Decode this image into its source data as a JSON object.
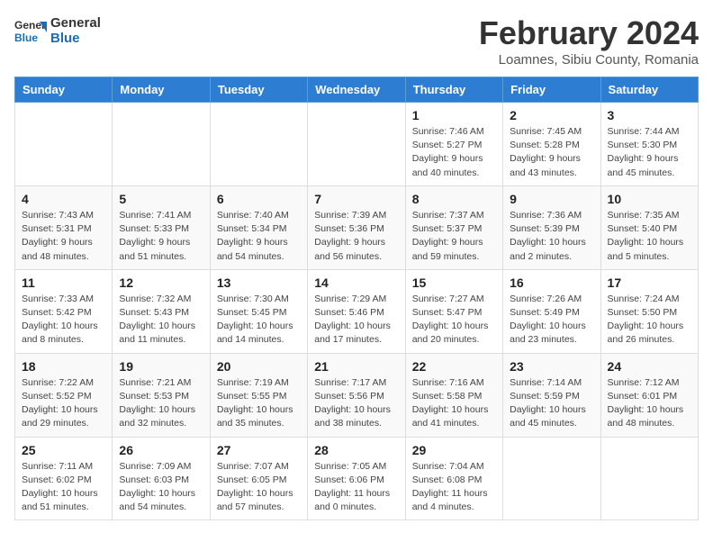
{
  "header": {
    "logo_line1": "General",
    "logo_line2": "Blue",
    "month_title": "February 2024",
    "subtitle": "Loamnes, Sibiu County, Romania"
  },
  "days_of_week": [
    "Sunday",
    "Monday",
    "Tuesday",
    "Wednesday",
    "Thursday",
    "Friday",
    "Saturday"
  ],
  "weeks": [
    [
      {
        "day": "",
        "info": ""
      },
      {
        "day": "",
        "info": ""
      },
      {
        "day": "",
        "info": ""
      },
      {
        "day": "",
        "info": ""
      },
      {
        "day": "1",
        "info": "Sunrise: 7:46 AM\nSunset: 5:27 PM\nDaylight: 9 hours\nand 40 minutes."
      },
      {
        "day": "2",
        "info": "Sunrise: 7:45 AM\nSunset: 5:28 PM\nDaylight: 9 hours\nand 43 minutes."
      },
      {
        "day": "3",
        "info": "Sunrise: 7:44 AM\nSunset: 5:30 PM\nDaylight: 9 hours\nand 45 minutes."
      }
    ],
    [
      {
        "day": "4",
        "info": "Sunrise: 7:43 AM\nSunset: 5:31 PM\nDaylight: 9 hours\nand 48 minutes."
      },
      {
        "day": "5",
        "info": "Sunrise: 7:41 AM\nSunset: 5:33 PM\nDaylight: 9 hours\nand 51 minutes."
      },
      {
        "day": "6",
        "info": "Sunrise: 7:40 AM\nSunset: 5:34 PM\nDaylight: 9 hours\nand 54 minutes."
      },
      {
        "day": "7",
        "info": "Sunrise: 7:39 AM\nSunset: 5:36 PM\nDaylight: 9 hours\nand 56 minutes."
      },
      {
        "day": "8",
        "info": "Sunrise: 7:37 AM\nSunset: 5:37 PM\nDaylight: 9 hours\nand 59 minutes."
      },
      {
        "day": "9",
        "info": "Sunrise: 7:36 AM\nSunset: 5:39 PM\nDaylight: 10 hours\nand 2 minutes."
      },
      {
        "day": "10",
        "info": "Sunrise: 7:35 AM\nSunset: 5:40 PM\nDaylight: 10 hours\nand 5 minutes."
      }
    ],
    [
      {
        "day": "11",
        "info": "Sunrise: 7:33 AM\nSunset: 5:42 PM\nDaylight: 10 hours\nand 8 minutes."
      },
      {
        "day": "12",
        "info": "Sunrise: 7:32 AM\nSunset: 5:43 PM\nDaylight: 10 hours\nand 11 minutes."
      },
      {
        "day": "13",
        "info": "Sunrise: 7:30 AM\nSunset: 5:45 PM\nDaylight: 10 hours\nand 14 minutes."
      },
      {
        "day": "14",
        "info": "Sunrise: 7:29 AM\nSunset: 5:46 PM\nDaylight: 10 hours\nand 17 minutes."
      },
      {
        "day": "15",
        "info": "Sunrise: 7:27 AM\nSunset: 5:47 PM\nDaylight: 10 hours\nand 20 minutes."
      },
      {
        "day": "16",
        "info": "Sunrise: 7:26 AM\nSunset: 5:49 PM\nDaylight: 10 hours\nand 23 minutes."
      },
      {
        "day": "17",
        "info": "Sunrise: 7:24 AM\nSunset: 5:50 PM\nDaylight: 10 hours\nand 26 minutes."
      }
    ],
    [
      {
        "day": "18",
        "info": "Sunrise: 7:22 AM\nSunset: 5:52 PM\nDaylight: 10 hours\nand 29 minutes."
      },
      {
        "day": "19",
        "info": "Sunrise: 7:21 AM\nSunset: 5:53 PM\nDaylight: 10 hours\nand 32 minutes."
      },
      {
        "day": "20",
        "info": "Sunrise: 7:19 AM\nSunset: 5:55 PM\nDaylight: 10 hours\nand 35 minutes."
      },
      {
        "day": "21",
        "info": "Sunrise: 7:17 AM\nSunset: 5:56 PM\nDaylight: 10 hours\nand 38 minutes."
      },
      {
        "day": "22",
        "info": "Sunrise: 7:16 AM\nSunset: 5:58 PM\nDaylight: 10 hours\nand 41 minutes."
      },
      {
        "day": "23",
        "info": "Sunrise: 7:14 AM\nSunset: 5:59 PM\nDaylight: 10 hours\nand 45 minutes."
      },
      {
        "day": "24",
        "info": "Sunrise: 7:12 AM\nSunset: 6:01 PM\nDaylight: 10 hours\nand 48 minutes."
      }
    ],
    [
      {
        "day": "25",
        "info": "Sunrise: 7:11 AM\nSunset: 6:02 PM\nDaylight: 10 hours\nand 51 minutes."
      },
      {
        "day": "26",
        "info": "Sunrise: 7:09 AM\nSunset: 6:03 PM\nDaylight: 10 hours\nand 54 minutes."
      },
      {
        "day": "27",
        "info": "Sunrise: 7:07 AM\nSunset: 6:05 PM\nDaylight: 10 hours\nand 57 minutes."
      },
      {
        "day": "28",
        "info": "Sunrise: 7:05 AM\nSunset: 6:06 PM\nDaylight: 11 hours\nand 0 minutes."
      },
      {
        "day": "29",
        "info": "Sunrise: 7:04 AM\nSunset: 6:08 PM\nDaylight: 11 hours\nand 4 minutes."
      },
      {
        "day": "",
        "info": ""
      },
      {
        "day": "",
        "info": ""
      }
    ]
  ]
}
